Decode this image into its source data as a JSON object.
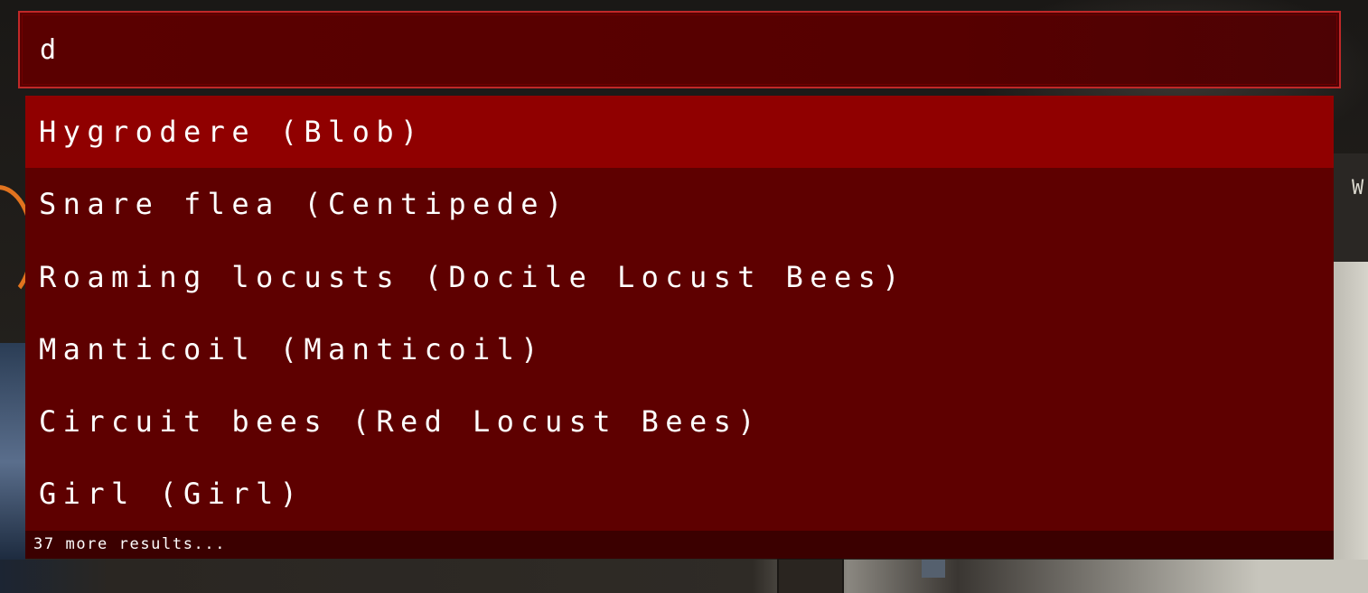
{
  "search": {
    "value": "d",
    "accent_color": "#c02828",
    "background_color": "#5a0000"
  },
  "results": {
    "selected_index": 0,
    "selected_color": "#900000",
    "item_color": "#5e0000",
    "items": [
      {
        "label": "Hygrodere (Blob)"
      },
      {
        "label": "Snare flea (Centipede)"
      },
      {
        "label": "Roaming locusts (Docile Locust Bees)"
      },
      {
        "label": "Manticoil (Manticoil)"
      },
      {
        "label": "Circuit bees (Red Locust Bees)"
      },
      {
        "label": "Girl (Girl)"
      }
    ],
    "more_text": "37 more results..."
  },
  "background": {
    "edge_glyph": "W"
  }
}
